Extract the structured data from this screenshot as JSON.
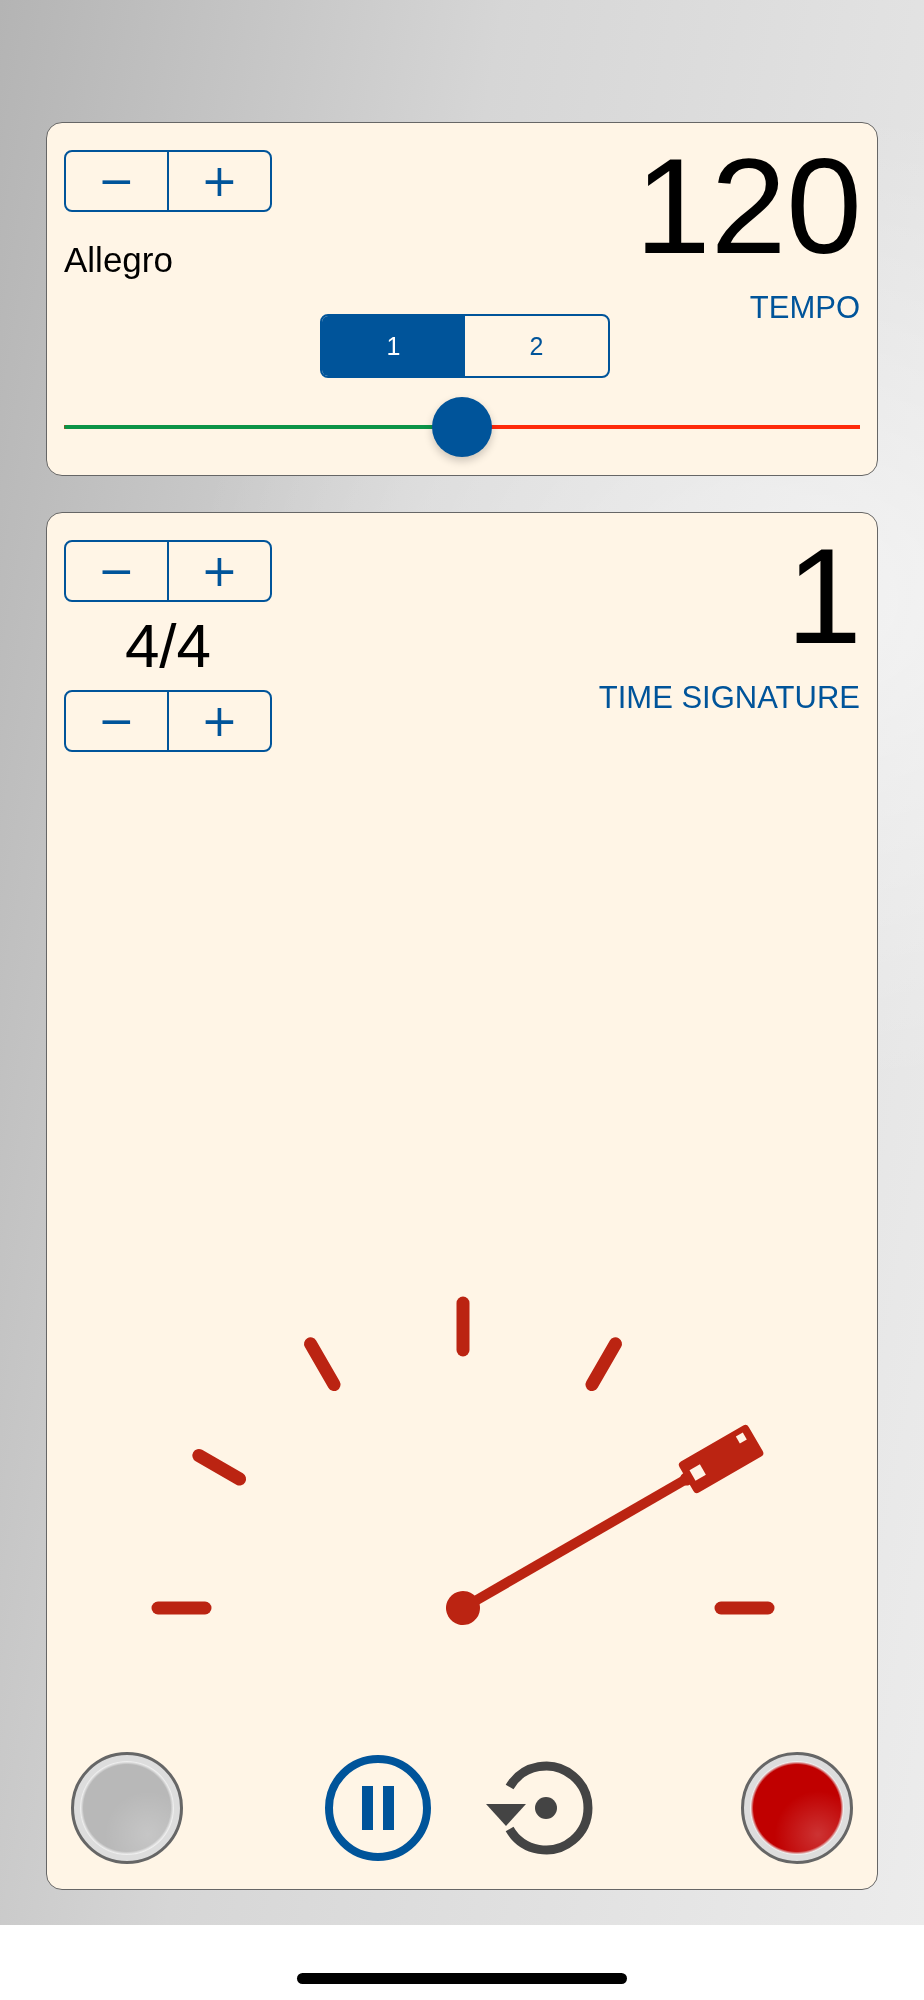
{
  "tempo": {
    "decrease": "−",
    "increase": "+",
    "marking": "Allegro",
    "value": "120",
    "label": "TEMPO",
    "modes": [
      {
        "label": "1",
        "selected": true
      },
      {
        "label": "2",
        "selected": false
      }
    ],
    "slider": {
      "level": 0.5
    }
  },
  "meter": {
    "upper": {
      "decrease": "−",
      "increase": "+"
    },
    "signature": "4/4",
    "lower": {
      "decrease": "−",
      "increase": "+"
    },
    "beat": "1",
    "label": "TIME SIGNATURE"
  },
  "controls": [
    {
      "kind": "lamp",
      "color": "#b8b8b8"
    },
    {
      "kind": "pause"
    },
    {
      "kind": "reset"
    },
    {
      "kind": "lamp",
      "color": "#c00000"
    }
  ]
}
